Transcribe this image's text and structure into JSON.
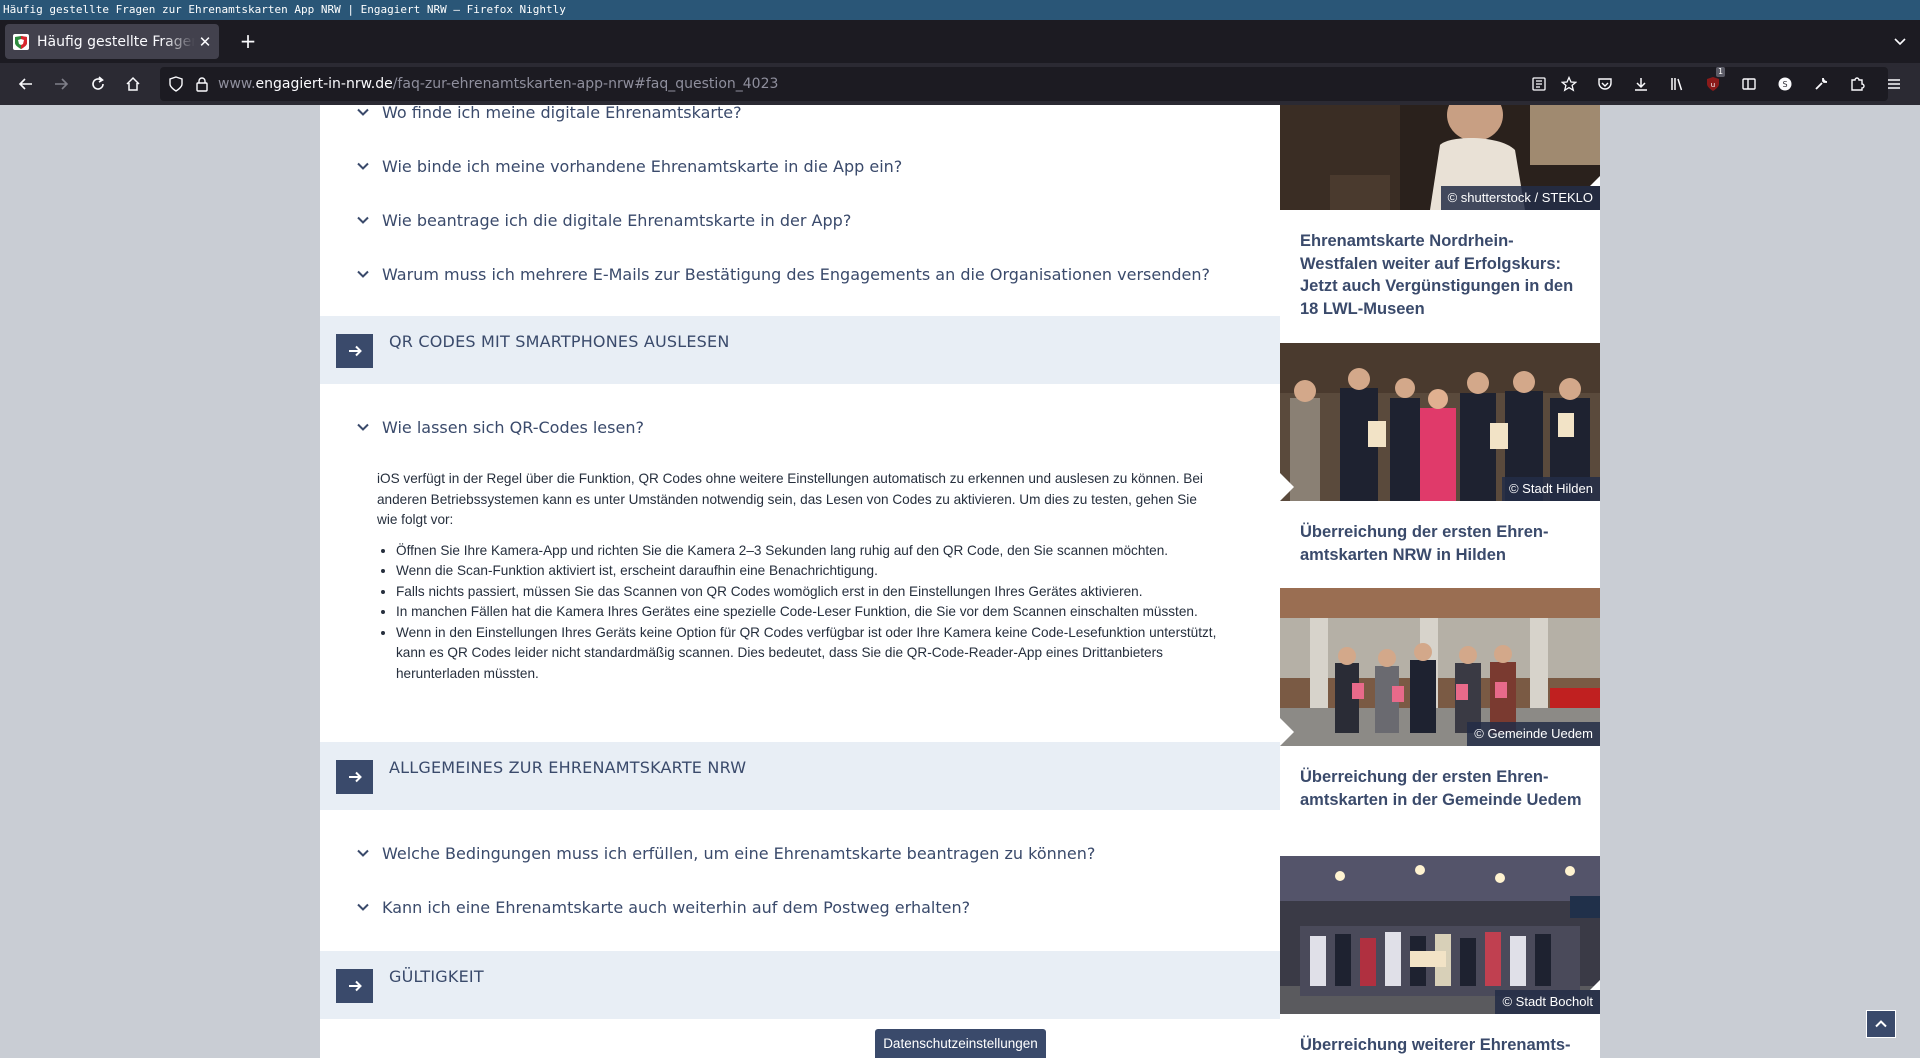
{
  "window": {
    "title": "Häufig gestellte Fragen zur Ehrenamtskarten App NRW | Engagiert NRW — Firefox Nightly"
  },
  "tab": {
    "title": "Häufig gestellte Fragen zur Ehrenamtskarten App NRW",
    "close_label": "✕",
    "new_tab_label": "+"
  },
  "urlbar": {
    "prefix": "www.",
    "domain": "engagiert-in-nrw.de",
    "path": "/faq-zur-ehrenamtskarten-app-nrw#faq_question_4023"
  },
  "toolbar": {
    "notification_count": "1"
  },
  "faq": {
    "top_questions": [
      "Wo finde ich meine digitale Ehrenamtskarte?",
      "Wie binde ich meine vorhandene Ehrenamtskarte in die App ein?",
      "Wie beantrage ich die digitale Ehrenamtskarte in der App?",
      "Warum muss ich mehrere E-Mails zur Bestätigung des Engagements an die Organisationen versenden?"
    ],
    "sections": [
      {
        "title": "QR CODES MIT SMARTPHONES AUSLESEN"
      },
      {
        "title": "ALLGEMEINES ZUR EHRENAMTSKARTE NRW"
      },
      {
        "title": "GÜLTIGKEIT"
      }
    ],
    "qr_question": "Wie lassen sich QR-Codes lesen?",
    "qr_answer": {
      "intro": "iOS verfügt in der Regel über die Funktion, QR Codes ohne weitere Einstellungen automatisch zu erkennen und auslesen zu können. Bei anderen Betriebssystemen kann es unter Umständen notwendig sein, das Lesen von Codes zu aktivieren. Um dies zu testen, gehen Sie wie folgt vor:",
      "bullets": [
        "Öffnen Sie Ihre Kamera-App und richten Sie die Kamera 2–3 Sekunden lang ruhig auf den QR Code, den Sie scannen möchten.",
        "Wenn die Scan-Funktion aktiviert ist, erscheint daraufhin eine Benachrichtigung.",
        "Falls nichts passiert, müssen Sie das Scannen von QR Codes womöglich erst in den Einstellungen Ihres Gerätes aktivieren.",
        "In manchen Fällen hat die Kamera Ihres Gerätes eine spezielle Code-Leser Funktion, die Sie vor dem Scannen einschalten müssten.",
        "Wenn in den Einstellungen Ihres Geräts keine Option für QR Codes verfügbar ist oder Ihre Kamera keine Code-Lesefunktion unterstützt, kann es QR Codes leider nicht standardmäßig scannen. Dies bedeutet, dass Sie die QR-Code-Reader-App eines Drittanbieters herunterladen müssten."
      ]
    },
    "general_questions": [
      "Welche Bedingungen muss ich erfüllen, um eine Ehrenamtskarte beantragen zu können?",
      "Kann ich eine Ehrenamtskarte auch weiterhin auf dem Postweg erhalten?"
    ]
  },
  "sidebar": {
    "cards": [
      {
        "credit": "© shutterstock / STEKLO",
        "title": "Ehrenamtskarte Nordrhein-Westfalen weiter auf Erfolgskurs: Jetzt auch Vergünstigungen in den 18 LWL-Museen"
      },
      {
        "credit": "© Stadt Hilden",
        "title": "Überreichung der ersten Ehren­amtskarten NRW in Hilden"
      },
      {
        "credit": "© Gemeinde Uedem",
        "title": "Überreichung der ersten Ehren­amtskarten in der Gemeinde Ue­dem"
      },
      {
        "credit": "© Stadt Bocholt",
        "title": "Überreichung weiterer Ehrenamts-"
      }
    ]
  },
  "privacy_button": "Datenschutzeinstellungen",
  "colors": {
    "accent": "#3a4a6b",
    "section_bg": "#e8eef5",
    "page_bg": "#c9cdd4",
    "chrome_dark": "#1c1b22"
  }
}
